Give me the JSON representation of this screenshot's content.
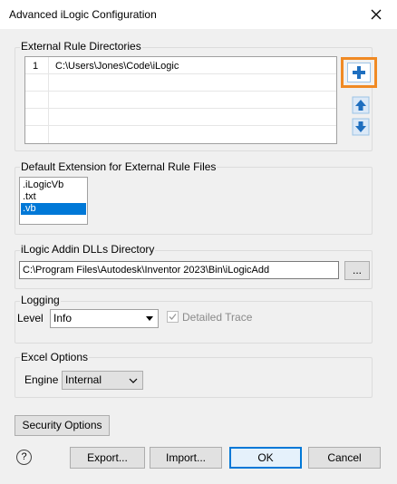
{
  "window": {
    "title": "Advanced iLogic Configuration"
  },
  "external_rules": {
    "label": "External Rule Directories",
    "rows": [
      {
        "num": "1",
        "path": "C:\\Users\\Jones\\Code\\iLogic"
      }
    ]
  },
  "extension": {
    "label": "Default Extension for External Rule Files",
    "items": [
      ".iLogicVb",
      ".txt",
      ".vb"
    ],
    "selected": ".vb"
  },
  "addin": {
    "label": "iLogic Addin DLLs Directory",
    "path": "C:\\Program Files\\Autodesk\\Inventor 2023\\Bin\\iLogicAdd",
    "browse_label": "..."
  },
  "logging": {
    "label": "Logging",
    "level_label": "Level",
    "level_value": "Info",
    "detailed_trace_label": "Detailed Trace",
    "detailed_trace_checked": true
  },
  "excel": {
    "label": "Excel Options",
    "engine_label": "Engine",
    "engine_value": "Internal"
  },
  "buttons": {
    "security": "Security Options",
    "export": "Export...",
    "import": "Import...",
    "ok": "OK",
    "cancel": "Cancel",
    "help": "?"
  },
  "colors": {
    "highlight": "#f08a24",
    "selection": "#0078d7",
    "arrow_blue": "#1f6fbf"
  }
}
